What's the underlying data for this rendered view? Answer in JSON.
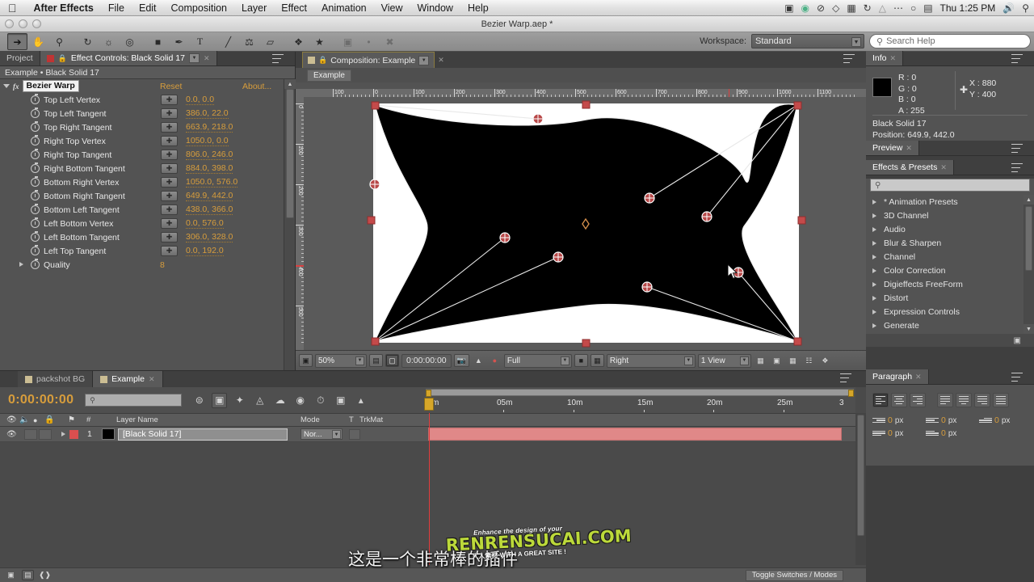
{
  "os": {
    "apple_menu": "apple-logo",
    "menu_items": [
      "After Effects",
      "File",
      "Edit",
      "Composition",
      "Layer",
      "Effect",
      "Animation",
      "View",
      "Window",
      "Help"
    ],
    "status_icons": [
      "screen-record-icon",
      "dropbox-icon",
      "do-not-disturb-icon",
      "diamond-icon",
      "display-icon",
      "sync-icon",
      "airplay-icon",
      "ellipsis-icon",
      "wifi-icon",
      "notification-icon"
    ],
    "clock": "Thu 1:25 PM",
    "volume_icon": "volume-icon",
    "spotlight_icon": "search-icon"
  },
  "window": {
    "document_title": "Bezier Warp.aep *"
  },
  "toolbar": {
    "tools": [
      "selection-tool",
      "hand-tool",
      "zoom-tool",
      "rotation-tool",
      "camera-tool",
      "pan-behind-tool",
      "shape-tool",
      "pen-tool",
      "text-tool",
      "brush-tool",
      "clone-stamp-tool",
      "eraser-tool",
      "roto-brush-tool",
      "puppet-pin-tool"
    ],
    "workspace_label": "Workspace:",
    "workspace_value": "Standard",
    "search_placeholder": "Search Help"
  },
  "effect_controls": {
    "tabs": [
      {
        "label": "Project",
        "active": false
      },
      {
        "label": "Effect Controls: Black Solid 17",
        "active": true
      }
    ],
    "header": "Example • Black Solid 17",
    "effect_name": "Bezier Warp",
    "reset_label": "Reset",
    "about_label": "About...",
    "properties": [
      {
        "name": "Top Left Vertex",
        "value": "0.0, 0.0"
      },
      {
        "name": "Top Left Tangent",
        "value": "386.0, 22.0"
      },
      {
        "name": "Top Right Tangent",
        "value": "663.9, 218.0"
      },
      {
        "name": "Right Top Vertex",
        "value": "1050.0, 0.0"
      },
      {
        "name": "Right Top Tangent",
        "value": "806.0, 246.0"
      },
      {
        "name": "Right Bottom Tangent",
        "value": "884.0, 398.0"
      },
      {
        "name": "Bottom Right Vertex",
        "value": "1050.0, 576.0"
      },
      {
        "name": "Bottom Right Tangent",
        "value": "649.9, 442.0"
      },
      {
        "name": "Bottom Left Tangent",
        "value": "438.0, 366.0"
      },
      {
        "name": "Left Bottom Vertex",
        "value": "0.0, 576.0"
      },
      {
        "name": "Left Bottom Tangent",
        "value": "306.0, 328.0"
      },
      {
        "name": "Left Top Tangent",
        "value": "0.0, 192.0"
      }
    ],
    "quality": {
      "name": "Quality",
      "value": "8"
    }
  },
  "composition": {
    "tab_label": "Composition: Example",
    "breadcrumb": "Example",
    "ruler_h_labels": [
      "100",
      "0",
      "100",
      "200",
      "300",
      "400",
      "500",
      "600",
      "700",
      "800",
      "900",
      "1000",
      "1100"
    ],
    "ruler_v_labels": [
      "0",
      "100",
      "200",
      "300",
      "400",
      "500"
    ],
    "toolbar": {
      "zoom": "50%",
      "time": "0:00:00:00",
      "resolution": "Full",
      "view_layout": "Right",
      "views": "1 View",
      "icons": [
        "always-preview-icon",
        "title-action-safe-icon",
        "toggle-mask-icon",
        "snapshot-icon",
        "show-snapshot-icon",
        "channel-icon",
        "region-of-interest-icon",
        "transparency-grid-icon",
        "timeline-icon",
        "comp-flowchart-icon",
        "fast-preview-icon",
        "grid-guides-icon",
        "3d-renderer-icon"
      ]
    }
  },
  "info_panel": {
    "tab_label": "Info",
    "r": "R : 0",
    "g": "G : 0",
    "b": "B : 0",
    "a": "A : 255",
    "x": "X : 880",
    "y": "Y : 400",
    "layer_name": "Black Solid 17",
    "position": "Position: 649.9, 442.0",
    "swatch_color": "#000000"
  },
  "preview_panel": {
    "tab_label": "Preview"
  },
  "effects_presets": {
    "tab_label": "Effects & Presets",
    "search_placeholder": "",
    "items": [
      "* Animation Presets",
      "3D Channel",
      "Audio",
      "Blur & Sharpen",
      "Channel",
      "Color Correction",
      "Digieffects FreeForm",
      "Distort",
      "Expression Controls",
      "Generate"
    ]
  },
  "paragraph_panel": {
    "tab_label": "Paragraph",
    "fields": [
      {
        "icon": "indent-left-icon",
        "value": "0",
        "unit": "px"
      },
      {
        "icon": "indent-right-icon",
        "value": "0",
        "unit": "px"
      },
      {
        "icon": "indent-first-line-icon",
        "value": "0",
        "unit": "px"
      },
      {
        "icon": "space-before-icon",
        "value": "0",
        "unit": "px"
      },
      {
        "icon": "space-after-icon",
        "value": "0",
        "unit": "px"
      }
    ]
  },
  "timeline": {
    "tabs": [
      {
        "label": "packshot BG",
        "active": false
      },
      {
        "label": "Example",
        "active": true
      }
    ],
    "current_time": "0:00:00:00",
    "search_placeholder": "",
    "columns": [
      "Layer Name",
      "Mode",
      "T",
      "TrkMat"
    ],
    "column_icons": [
      "eye-icon",
      "audio-icon",
      "solo-icon",
      "lock-icon",
      "label-icon",
      "number-icon"
    ],
    "layers": [
      {
        "index": "1",
        "name": "[Black Solid 17]",
        "mode": "Nor...",
        "color": "#c03434"
      }
    ],
    "time_labels": [
      "m",
      "05m",
      "10m",
      "15m",
      "20m",
      "25m",
      "3"
    ],
    "toggle_switches_label": "Toggle Switches / Modes",
    "footer_icons": [
      "comp-render-icon",
      "motion-blur-icon",
      "graph-editor-icon"
    ]
  },
  "overlay": {
    "subtitle": "这是一个非常棒的插件",
    "watermark_line1": "Enhance the design of your",
    "watermark_line2": "RENRENSUCAI.COM",
    "watermark_line3": "人人素材  WITH A GREAT SITE !"
  }
}
